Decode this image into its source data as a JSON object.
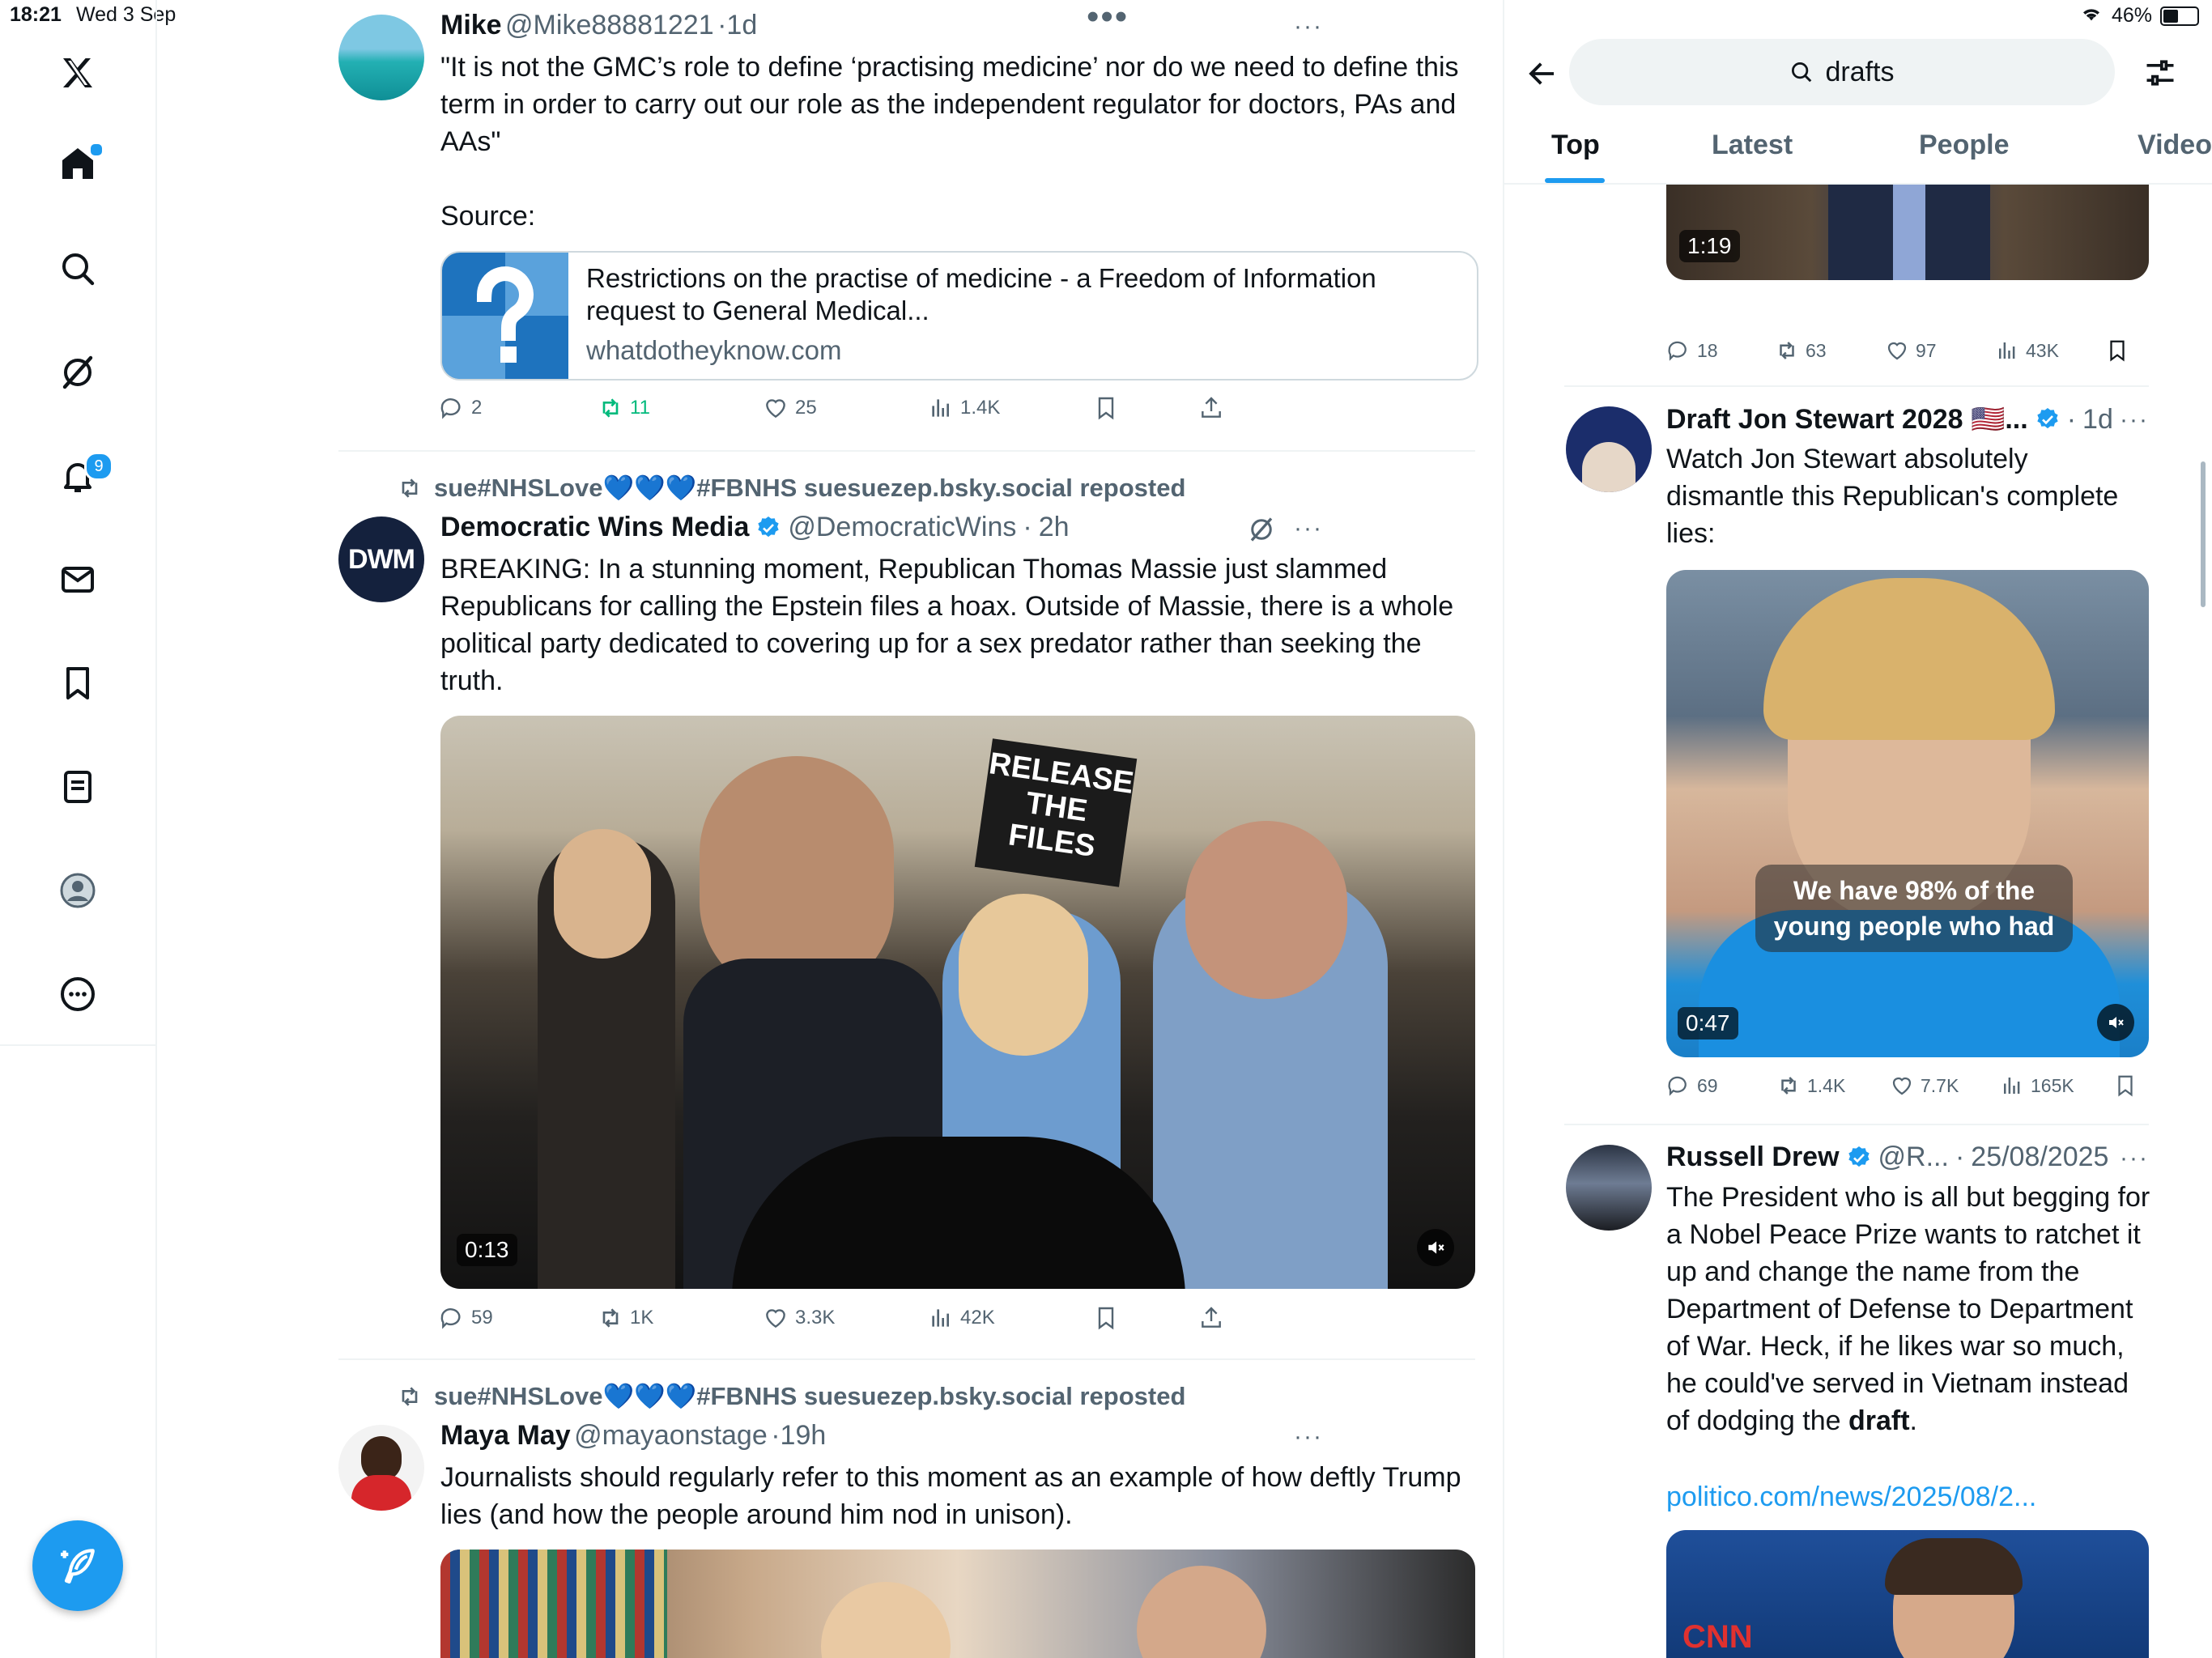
{
  "status": {
    "time": "18:21",
    "date": "Wed 3 Sep",
    "battery": "46%"
  },
  "nav": {
    "notifications_badge": "9"
  },
  "feed": {
    "post1": {
      "name": "Mike",
      "handle": "@Mike88881221",
      "time": "1d",
      "body": "\"It is not the GMC’s role to define ‘practising medicine’ nor do we need to define this term in order to carry out our role as the independent regulator for doctors, PAs and AAs\"",
      "source_label": "Source:",
      "card_title": "Restrictions on the practise of medicine - a Freedom of Information request to General Medical...",
      "card_domain": "whatdotheyknow.com",
      "replies": "2",
      "reposts": "11",
      "likes": "25",
      "views": "1.4K"
    },
    "post2": {
      "repost_by": "sue#NHSLove💙💙💙#FBNHS suesuezep.bsky.social reposted",
      "name": "Democratic Wins Media",
      "handle": "@DemocraticWins",
      "time": "2h",
      "avatar_text": "DWM",
      "body": "BREAKING: In a stunning moment, Republican Thomas Massie just slammed Republicans for calling the Epstein files a hoax. Outside of Massie, there is a whole political party dedicated to covering up for a sex predator rather than seeking the truth.",
      "sign1": "RELEASE THE FILES",
      "duration": "0:13",
      "replies": "59",
      "reposts": "1K",
      "likes": "3.3K",
      "views": "42K"
    },
    "post3": {
      "repost_by": "sue#NHSLove💙💙💙#FBNHS suesuezep.bsky.social reposted",
      "name": "Maya May",
      "handle": "@mayaonstage",
      "time": "19h",
      "body": "Journalists should regularly refer to this moment as an example of how deftly Trump lies (and how the people around him nod in unison)."
    }
  },
  "search": {
    "query": "drafts",
    "tabs": [
      "Top",
      "Latest",
      "People",
      "Video"
    ]
  },
  "results": {
    "r0": {
      "duration": "1:19",
      "replies": "18",
      "reposts": "63",
      "likes": "97",
      "views": "43K"
    },
    "r1": {
      "name": "Draft Jon Stewart 2028 🇺🇸...",
      "time": "1d",
      "body": "Watch Jon Stewart absolutely dismantle this Republican's complete lies:",
      "caption": "We have 98% of the young people who had",
      "duration": "0:47",
      "replies": "69",
      "reposts": "1.4K",
      "likes": "7.7K",
      "views": "165K"
    },
    "r2": {
      "name": "Russell Drew",
      "handle": "@R...",
      "time": "25/08/2025",
      "body_prefix": "The President who is all but begging for a Nobel Peace Prize wants to ratchet it up and change the name from the Department of Defense to Department of War. Heck, if he likes war so much, he could've served in Vietnam instead of dodging the ",
      "body_bold": "draft",
      "body_suffix": ".",
      "link": "politico.com/news/2025/08/2...",
      "logo": "CNN"
    }
  },
  "colors": {
    "accent": "#1d9bf0",
    "repost_green": "#00ba7c",
    "text": "#0f1419",
    "muted": "#536471"
  }
}
